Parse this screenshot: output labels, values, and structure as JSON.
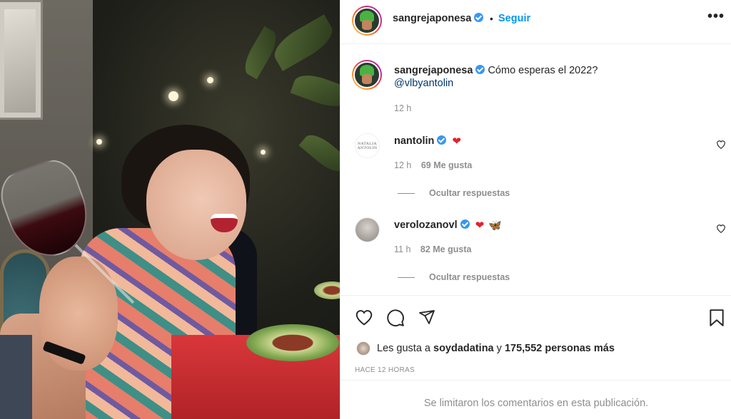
{
  "post": {
    "author": "sangrejaponesa",
    "separator": "•",
    "follow_label": "Seguir",
    "more_label": "•••"
  },
  "caption": {
    "author": "sangrejaponesa",
    "text": "Cómo esperas el 2022?",
    "mention": "@vlbyantolin",
    "time": "12 h"
  },
  "comments": [
    {
      "username": "nantolin",
      "avatar_text": "NATALIA ANTOLIN",
      "emoji": "❤",
      "time": "12 h",
      "likes": "69 Me gusta",
      "replies_label": "Ocultar respuestas"
    },
    {
      "username": "verolozanovl",
      "emoji": "❤",
      "emoji2": "🦋",
      "time": "11 h",
      "likes": "82 Me gusta",
      "replies_label": "Ocultar respuestas"
    }
  ],
  "likes": {
    "prefix": "Les gusta a",
    "user": "soydadatina",
    "connector": "y",
    "count": "175,552 personas más"
  },
  "time_ago": "HACE 12 HORAS",
  "comments_limited": "Se limitaron los comentarios en esta publicación.",
  "colors": {
    "accent": "#0095f6",
    "verified": "#3897f0",
    "heart": "#e0242e",
    "muted": "#8e8e8e"
  }
}
